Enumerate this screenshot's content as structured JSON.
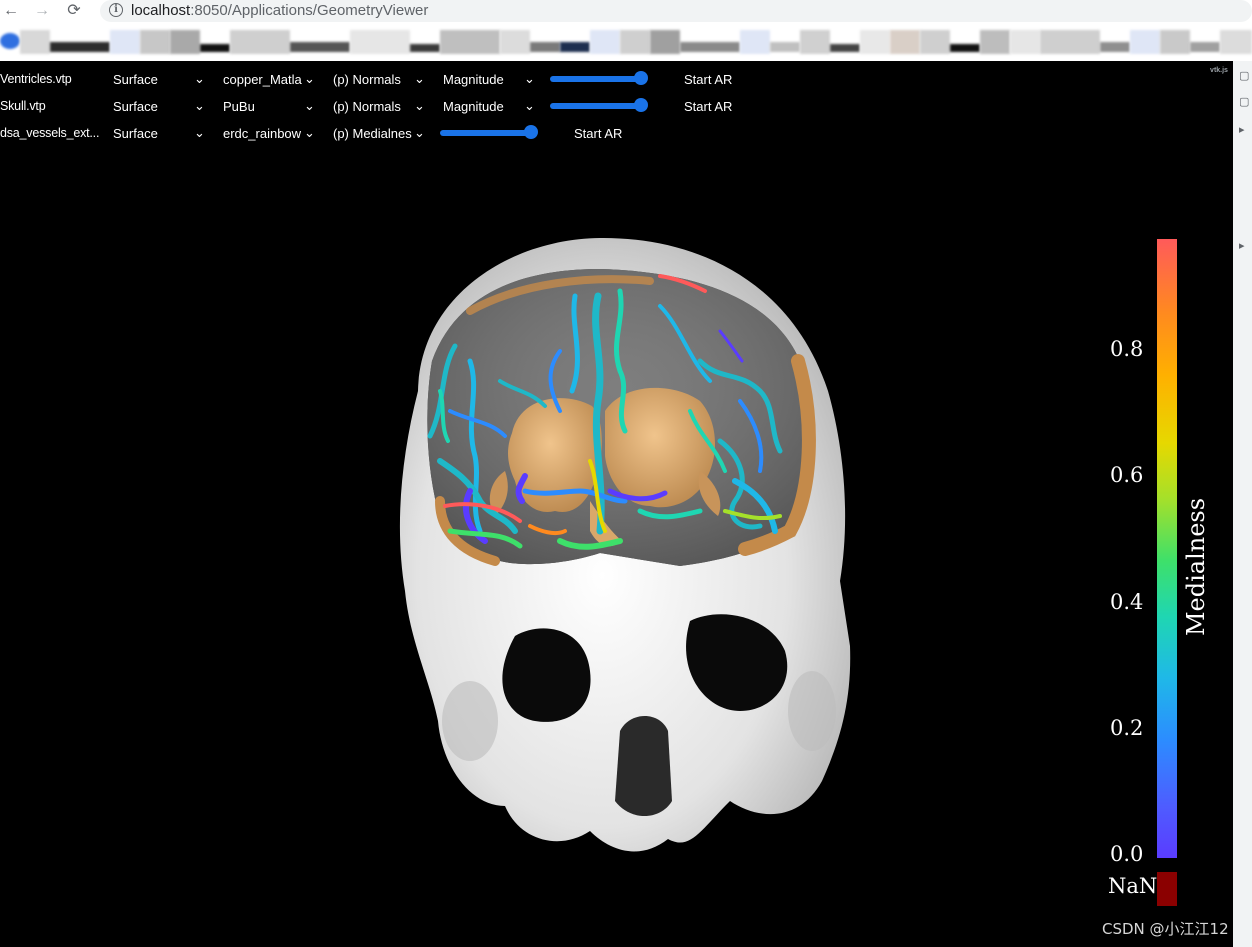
{
  "browser": {
    "back_icon": "←",
    "forward_icon": "→",
    "reload_icon": "⟳",
    "url_host": "localhost",
    "url_path": ":8050/Applications/GeometryViewer"
  },
  "controls": {
    "rows": [
      {
        "file": "Ventricles.vtp",
        "representation": "Surface",
        "colormap": "copper_Matla",
        "array": "(p) Normals",
        "component": "Magnitude",
        "opacity": 1.0,
        "ar_label": "Start AR"
      },
      {
        "file": "Skull.vtp",
        "representation": "Surface",
        "colormap": "PuBu",
        "array": "(p) Normals",
        "component": "Magnitude",
        "opacity": 1.0,
        "ar_label": "Start AR"
      },
      {
        "file": "dsa_vessels_ext...",
        "representation": "Surface",
        "colormap": "erdc_rainbow",
        "array": "(p) Medialnes",
        "opacity": 1.0,
        "ar_label": "Start AR"
      }
    ]
  },
  "logo_text": "vtk.js",
  "legend": {
    "title": "Medialness",
    "ticks": [
      "0.8",
      "0.6",
      "0.4",
      "0.2",
      "0.0"
    ],
    "nan_label": "NaN",
    "nan_color": "#8b0000"
  },
  "watermark": "CSDN @小江江12",
  "colors": {
    "background": "#000000",
    "accent": "#1a73e8",
    "skull": "#d9d9d9",
    "ventricles": "#d9a86a"
  }
}
